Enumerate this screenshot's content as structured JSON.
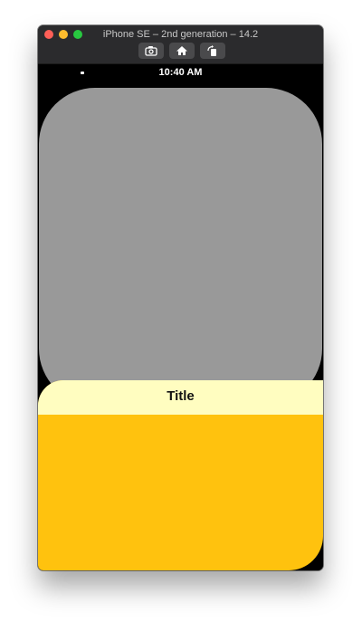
{
  "window": {
    "title": "iPhone SE – 2nd generation – 14.2"
  },
  "toolbar": {
    "buttons": [
      {
        "icon": "camera-icon"
      },
      {
        "icon": "home-icon"
      },
      {
        "icon": "rotate-icon"
      }
    ]
  },
  "status_bar": {
    "time": "10:40 AM"
  },
  "sheet": {
    "title": "Title"
  },
  "colors": {
    "gray_card": "#999999",
    "sheet_header": "#fffdc0",
    "sheet_body": "#ffc20e"
  }
}
